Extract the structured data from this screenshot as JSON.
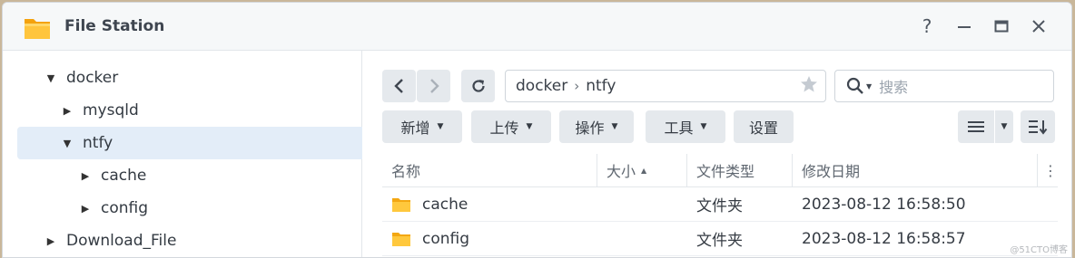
{
  "window": {
    "title": "File Station"
  },
  "sidebar": {
    "items": [
      {
        "label": "docker",
        "expanded": true
      },
      {
        "label": "mysqld",
        "expanded": false
      },
      {
        "label": "ntfy",
        "expanded": true,
        "selected": true
      },
      {
        "label": "cache",
        "expanded": false
      },
      {
        "label": "config",
        "expanded": false
      },
      {
        "label": "Download_File",
        "expanded": false
      }
    ]
  },
  "toolbar": {
    "path": [
      "docker",
      "ntfy"
    ],
    "search_placeholder": "搜索",
    "buttons": [
      "新增",
      "上传",
      "操作",
      "工具",
      "设置"
    ]
  },
  "table": {
    "columns": [
      "名称",
      "大小",
      "文件类型",
      "修改日期"
    ],
    "rows": [
      {
        "name": "cache",
        "size": "",
        "type": "文件夹",
        "modified": "2023-08-12 16:58:50"
      },
      {
        "name": "config",
        "size": "",
        "type": "文件夹",
        "modified": "2023-08-12 16:58:57"
      }
    ]
  },
  "watermark": "@51CTO博客",
  "colors": {
    "accent": "#e3edf8",
    "button_bg": "#e5e9ed",
    "folder": "#f6b93b"
  }
}
